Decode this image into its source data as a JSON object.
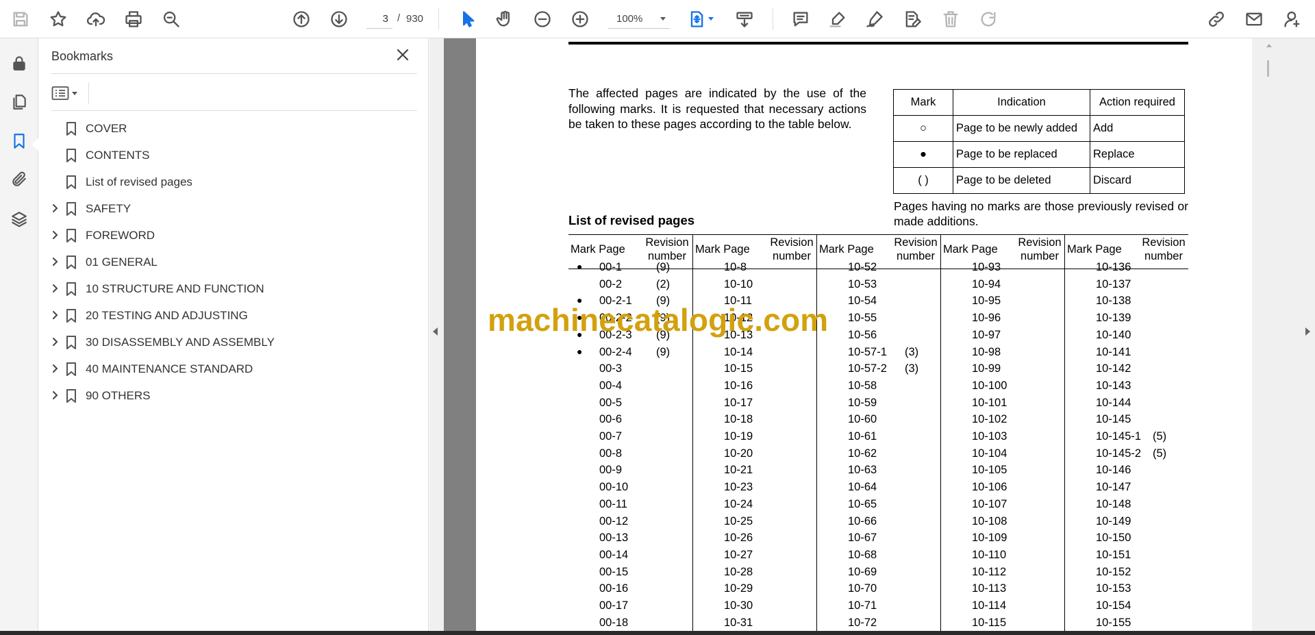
{
  "toolbar": {
    "page_current": "3",
    "page_separator": "/",
    "page_total": "930",
    "zoom": "100%"
  },
  "bookmarks": {
    "title": "Bookmarks",
    "items": [
      {
        "label": "COVER",
        "expandable": false
      },
      {
        "label": "CONTENTS",
        "expandable": false
      },
      {
        "label": "List of revised pages",
        "expandable": false
      },
      {
        "label": "SAFETY",
        "expandable": true
      },
      {
        "label": "FOREWORD",
        "expandable": true
      },
      {
        "label": "01 GENERAL",
        "expandable": true
      },
      {
        "label": "10 STRUCTURE AND FUNCTION",
        "expandable": true
      },
      {
        "label": "20 TESTING AND ADJUSTING",
        "expandable": true
      },
      {
        "label": "30 DISASSEMBLY AND ASSEMBLY",
        "expandable": true
      },
      {
        "label": "40 MAINTENANCE STANDARD",
        "expandable": true
      },
      {
        "label": "90 OTHERS",
        "expandable": true
      }
    ]
  },
  "document": {
    "intro": "The affected pages are indicated by the use of the following marks. It is requested that necessary actions be taken to these pages according to the table below.",
    "legend": {
      "headers": [
        "Mark",
        "Indication",
        "Action required"
      ],
      "rows": [
        {
          "mark": "○",
          "indication": "Page to be newly added",
          "action": "Add"
        },
        {
          "mark": "●",
          "indication": "Page to be replaced",
          "action": "Replace"
        },
        {
          "mark": "( )",
          "indication": "Page to be deleted",
          "action": "Discard"
        }
      ]
    },
    "note": "Pages having no marks are those previously revised or made additions.",
    "list_title": "List of revised pages",
    "col_header_markpage": "Mark Page",
    "col_header_revision": "Revision number",
    "columns": [
      {
        "rows": [
          {
            "mark": "●",
            "page": "00-1",
            "rev": "(9)"
          },
          {
            "mark": "",
            "page": "00-2",
            "rev": "(2)"
          },
          {
            "mark": "●",
            "page": "00-2-1",
            "rev": "(9)"
          },
          {
            "mark": "●",
            "page": "00-2-2",
            "rev": "(9)"
          },
          {
            "mark": "●",
            "page": "00-2-3",
            "rev": "(9)"
          },
          {
            "mark": "●",
            "page": "00-2-4",
            "rev": "(9)"
          },
          {
            "mark": "",
            "page": "00-3",
            "rev": ""
          },
          {
            "mark": "",
            "page": "00-4",
            "rev": ""
          },
          {
            "mark": "",
            "page": "00-5",
            "rev": ""
          },
          {
            "mark": "",
            "page": "00-6",
            "rev": ""
          },
          {
            "mark": "",
            "page": "00-7",
            "rev": ""
          },
          {
            "mark": "",
            "page": "00-8",
            "rev": ""
          },
          {
            "mark": "",
            "page": "00-9",
            "rev": ""
          },
          {
            "mark": "",
            "page": "00-10",
            "rev": ""
          },
          {
            "mark": "",
            "page": "00-11",
            "rev": ""
          },
          {
            "mark": "",
            "page": "00-12",
            "rev": ""
          },
          {
            "mark": "",
            "page": "00-13",
            "rev": ""
          },
          {
            "mark": "",
            "page": "00-14",
            "rev": ""
          },
          {
            "mark": "",
            "page": "00-15",
            "rev": ""
          },
          {
            "mark": "",
            "page": "00-16",
            "rev": ""
          },
          {
            "mark": "",
            "page": "00-17",
            "rev": ""
          },
          {
            "mark": "",
            "page": "00-18",
            "rev": ""
          }
        ]
      },
      {
        "rows": [
          {
            "mark": "",
            "page": "10-8",
            "rev": ""
          },
          {
            "mark": "",
            "page": "10-10",
            "rev": ""
          },
          {
            "mark": "",
            "page": "10-11",
            "rev": ""
          },
          {
            "mark": "",
            "page": "10-12",
            "rev": ""
          },
          {
            "mark": "",
            "page": "10-13",
            "rev": ""
          },
          {
            "mark": "",
            "page": "10-14",
            "rev": ""
          },
          {
            "mark": "",
            "page": "10-15",
            "rev": ""
          },
          {
            "mark": "",
            "page": "10-16",
            "rev": ""
          },
          {
            "mark": "",
            "page": "10-17",
            "rev": ""
          },
          {
            "mark": "",
            "page": "10-18",
            "rev": ""
          },
          {
            "mark": "",
            "page": "10-19",
            "rev": ""
          },
          {
            "mark": "",
            "page": "10-20",
            "rev": ""
          },
          {
            "mark": "",
            "page": "10-21",
            "rev": ""
          },
          {
            "mark": "",
            "page": "10-23",
            "rev": ""
          },
          {
            "mark": "",
            "page": "10-24",
            "rev": ""
          },
          {
            "mark": "",
            "page": "10-25",
            "rev": ""
          },
          {
            "mark": "",
            "page": "10-26",
            "rev": ""
          },
          {
            "mark": "",
            "page": "10-27",
            "rev": ""
          },
          {
            "mark": "",
            "page": "10-28",
            "rev": ""
          },
          {
            "mark": "",
            "page": "10-29",
            "rev": ""
          },
          {
            "mark": "",
            "page": "10-30",
            "rev": ""
          },
          {
            "mark": "",
            "page": "10-31",
            "rev": ""
          }
        ]
      },
      {
        "rows": [
          {
            "mark": "",
            "page": "10-52",
            "rev": ""
          },
          {
            "mark": "",
            "page": "10-53",
            "rev": ""
          },
          {
            "mark": "",
            "page": "10-54",
            "rev": ""
          },
          {
            "mark": "",
            "page": "10-55",
            "rev": ""
          },
          {
            "mark": "",
            "page": "10-56",
            "rev": ""
          },
          {
            "mark": "",
            "page": "10-57-1",
            "rev": "(3)"
          },
          {
            "mark": "",
            "page": "10-57-2",
            "rev": "(3)"
          },
          {
            "mark": "",
            "page": "10-58",
            "rev": ""
          },
          {
            "mark": "",
            "page": "10-59",
            "rev": ""
          },
          {
            "mark": "",
            "page": "10-60",
            "rev": ""
          },
          {
            "mark": "",
            "page": "10-61",
            "rev": ""
          },
          {
            "mark": "",
            "page": "10-62",
            "rev": ""
          },
          {
            "mark": "",
            "page": "10-63",
            "rev": ""
          },
          {
            "mark": "",
            "page": "10-64",
            "rev": ""
          },
          {
            "mark": "",
            "page": "10-65",
            "rev": ""
          },
          {
            "mark": "",
            "page": "10-66",
            "rev": ""
          },
          {
            "mark": "",
            "page": "10-67",
            "rev": ""
          },
          {
            "mark": "",
            "page": "10-68",
            "rev": ""
          },
          {
            "mark": "",
            "page": "10-69",
            "rev": ""
          },
          {
            "mark": "",
            "page": "10-70",
            "rev": ""
          },
          {
            "mark": "",
            "page": "10-71",
            "rev": ""
          },
          {
            "mark": "",
            "page": "10-72",
            "rev": ""
          }
        ]
      },
      {
        "rows": [
          {
            "mark": "",
            "page": "10-93",
            "rev": ""
          },
          {
            "mark": "",
            "page": "10-94",
            "rev": ""
          },
          {
            "mark": "",
            "page": "10-95",
            "rev": ""
          },
          {
            "mark": "",
            "page": "10-96",
            "rev": ""
          },
          {
            "mark": "",
            "page": "10-97",
            "rev": ""
          },
          {
            "mark": "",
            "page": "10-98",
            "rev": ""
          },
          {
            "mark": "",
            "page": "10-99",
            "rev": ""
          },
          {
            "mark": "",
            "page": "10-100",
            "rev": ""
          },
          {
            "mark": "",
            "page": "10-101",
            "rev": ""
          },
          {
            "mark": "",
            "page": "10-102",
            "rev": ""
          },
          {
            "mark": "",
            "page": "10-103",
            "rev": ""
          },
          {
            "mark": "",
            "page": "10-104",
            "rev": ""
          },
          {
            "mark": "",
            "page": "10-105",
            "rev": ""
          },
          {
            "mark": "",
            "page": "10-106",
            "rev": ""
          },
          {
            "mark": "",
            "page": "10-107",
            "rev": ""
          },
          {
            "mark": "",
            "page": "10-108",
            "rev": ""
          },
          {
            "mark": "",
            "page": "10-109",
            "rev": ""
          },
          {
            "mark": "",
            "page": "10-110",
            "rev": ""
          },
          {
            "mark": "",
            "page": "10-112",
            "rev": ""
          },
          {
            "mark": "",
            "page": "10-113",
            "rev": ""
          },
          {
            "mark": "",
            "page": "10-114",
            "rev": ""
          },
          {
            "mark": "",
            "page": "10-115",
            "rev": ""
          }
        ]
      },
      {
        "rows": [
          {
            "mark": "",
            "page": "10-136",
            "rev": ""
          },
          {
            "mark": "",
            "page": "10-137",
            "rev": ""
          },
          {
            "mark": "",
            "page": "10-138",
            "rev": ""
          },
          {
            "mark": "",
            "page": "10-139",
            "rev": ""
          },
          {
            "mark": "",
            "page": "10-140",
            "rev": ""
          },
          {
            "mark": "",
            "page": "10-141",
            "rev": ""
          },
          {
            "mark": "",
            "page": "10-142",
            "rev": ""
          },
          {
            "mark": "",
            "page": "10-143",
            "rev": ""
          },
          {
            "mark": "",
            "page": "10-144",
            "rev": ""
          },
          {
            "mark": "",
            "page": "10-145",
            "rev": ""
          },
          {
            "mark": "",
            "page": "10-145-1",
            "rev": "(5)"
          },
          {
            "mark": "",
            "page": "10-145-2",
            "rev": "(5)"
          },
          {
            "mark": "",
            "page": "10-146",
            "rev": ""
          },
          {
            "mark": "",
            "page": "10-147",
            "rev": ""
          },
          {
            "mark": "",
            "page": "10-148",
            "rev": ""
          },
          {
            "mark": "",
            "page": "10-149",
            "rev": ""
          },
          {
            "mark": "",
            "page": "10-150",
            "rev": ""
          },
          {
            "mark": "",
            "page": "10-151",
            "rev": ""
          },
          {
            "mark": "",
            "page": "10-152",
            "rev": ""
          },
          {
            "mark": "",
            "page": "10-153",
            "rev": ""
          },
          {
            "mark": "",
            "page": "10-154",
            "rev": ""
          },
          {
            "mark": "",
            "page": "10-155",
            "rev": ""
          }
        ]
      }
    ],
    "watermark": "machinecatalogic.com"
  },
  "colors": {
    "accent": "#1473e6",
    "watermark": "#d3a10e",
    "doc_background": "#808080"
  }
}
